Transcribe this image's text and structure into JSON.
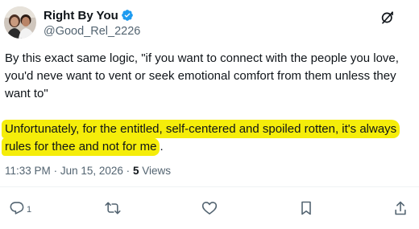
{
  "author": {
    "display_name": "Right By You",
    "handle": "@Good_Rel_2226",
    "verified": true
  },
  "tweet": {
    "paragraph_1": "By this exact same logic, \"if you want to connect with the people you love, you'd neve want to vent or seek emotional comfort from them unless they want to\"",
    "paragraph_2_highlighted": "Unfortunately, for the entitled, self-centered and spoiled rotten, it's always rules for thee and not for me",
    "paragraph_2_tail": "."
  },
  "meta": {
    "time": "11:33 PM",
    "separator": "·",
    "date": "Jun 15, 2026",
    "views_count": "5",
    "views_label": "Views"
  },
  "actions": {
    "reply_count": "1"
  },
  "colors": {
    "highlight": "#f5ed0a",
    "verified_badge": "#1d9bf0",
    "secondary_text": "#536471"
  },
  "icons": {
    "verified": "verified-badge-icon",
    "more": "grok-icon",
    "reply": "reply-icon",
    "retweet": "retweet-icon",
    "like": "heart-icon",
    "bookmark": "bookmark-icon",
    "share": "share-icon"
  }
}
